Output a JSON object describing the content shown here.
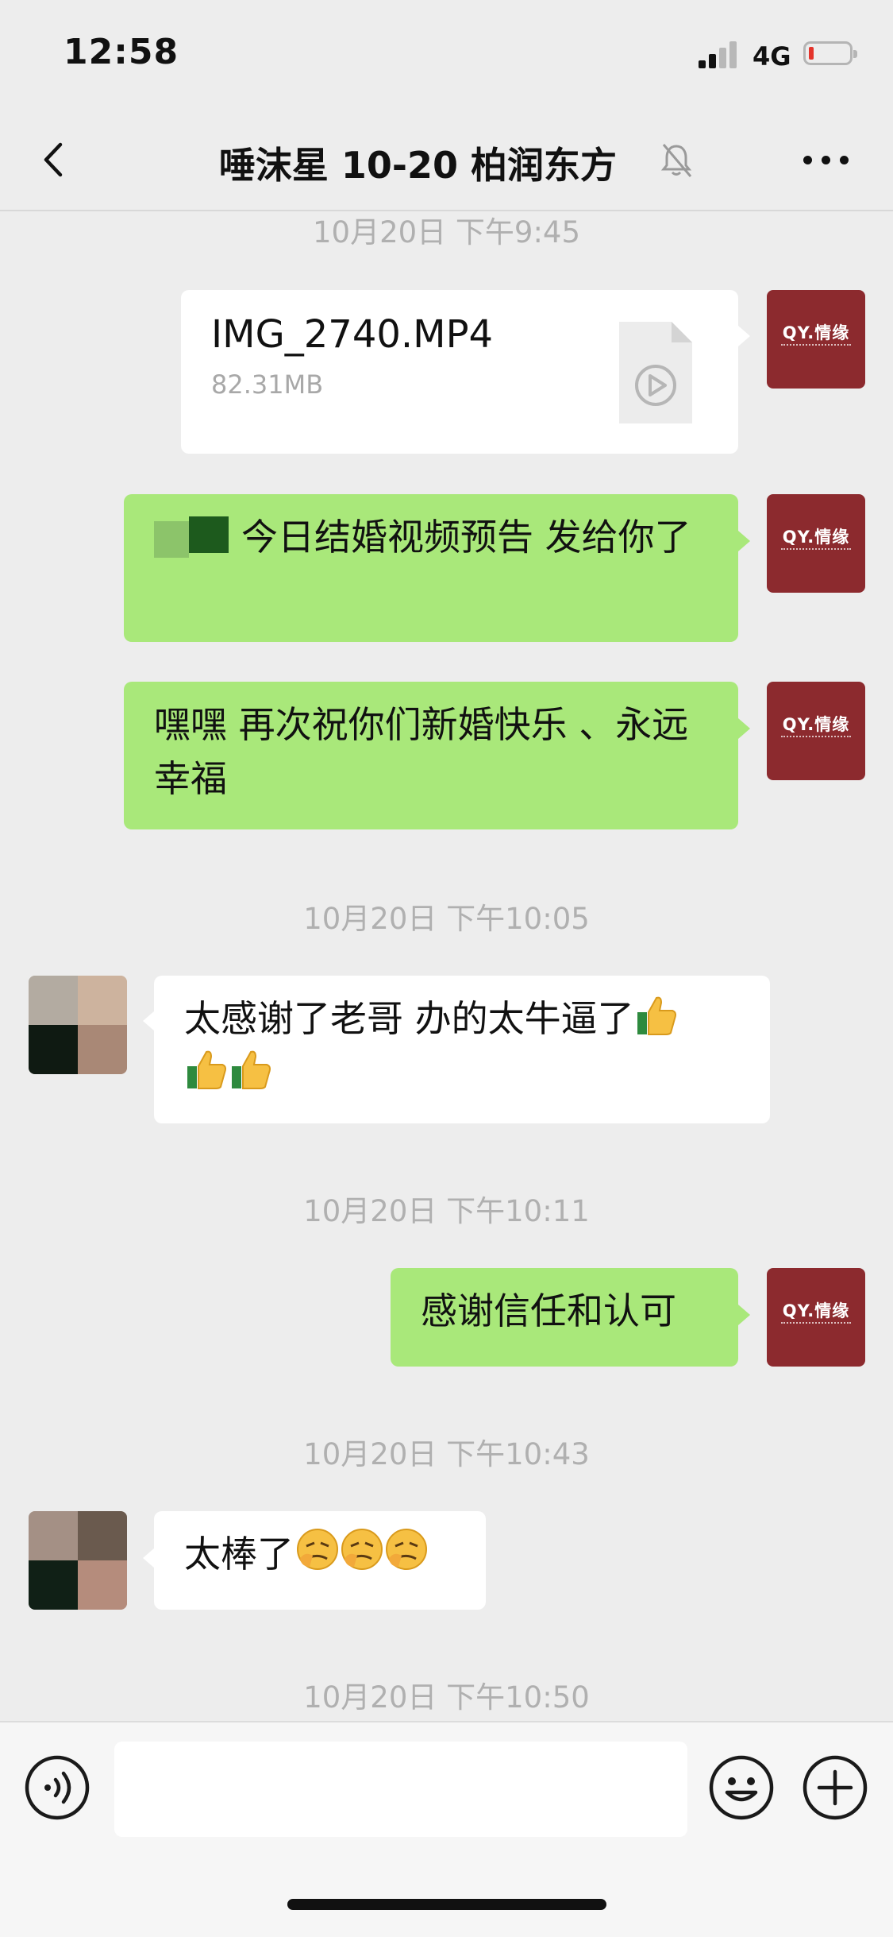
{
  "status_bar": {
    "time": "12:58",
    "network": "4G"
  },
  "nav": {
    "title": "唾沫星 10-20 柏润东方",
    "back_icon": "chevron-left-icon",
    "mute_icon": "bell-slash-icon",
    "more_icon": "more-dots-icon"
  },
  "brand_avatar": {
    "logo_text": "QY.情缘",
    "color": "#8c2a2e"
  },
  "messages": [
    {
      "type": "timestamp",
      "text": "10月20日 下午9:45"
    },
    {
      "type": "file",
      "sender": "self",
      "file_name": "IMG_2740.MP4",
      "file_size": "82.31MB",
      "icon": "video-file-icon"
    },
    {
      "type": "text",
      "sender": "self",
      "text": "今日结婚视频预告 发给你了"
    },
    {
      "type": "text",
      "sender": "self",
      "text": "嘿嘿 再次祝你们新婚快乐 、永远幸福"
    },
    {
      "type": "timestamp",
      "text": "10月20日 下午10:05"
    },
    {
      "type": "text",
      "sender": "other",
      "text": "太感谢了老哥 办的太牛逼了",
      "emoji": [
        "thumbs-up",
        "thumbs-up",
        "thumbs-up"
      ]
    },
    {
      "type": "timestamp",
      "text": "10月20日 下午10:11"
    },
    {
      "type": "text",
      "sender": "self",
      "text": "感谢信任和认可"
    },
    {
      "type": "timestamp",
      "text": "10月20日 下午10:43"
    },
    {
      "type": "text",
      "sender": "other",
      "text": "太棒了",
      "emoji": [
        "smirk-face",
        "smirk-face",
        "smirk-face"
      ]
    },
    {
      "type": "timestamp",
      "text": "10月20日 下午10:50"
    }
  ],
  "input_bar": {
    "voice_icon": "voice-icon",
    "emoji_icon": "emoji-icon",
    "plus_icon": "plus-icon",
    "placeholder": ""
  },
  "colors": {
    "self_bubble": "#a9e87a",
    "other_bubble": "#ffffff",
    "background": "#ededed"
  }
}
